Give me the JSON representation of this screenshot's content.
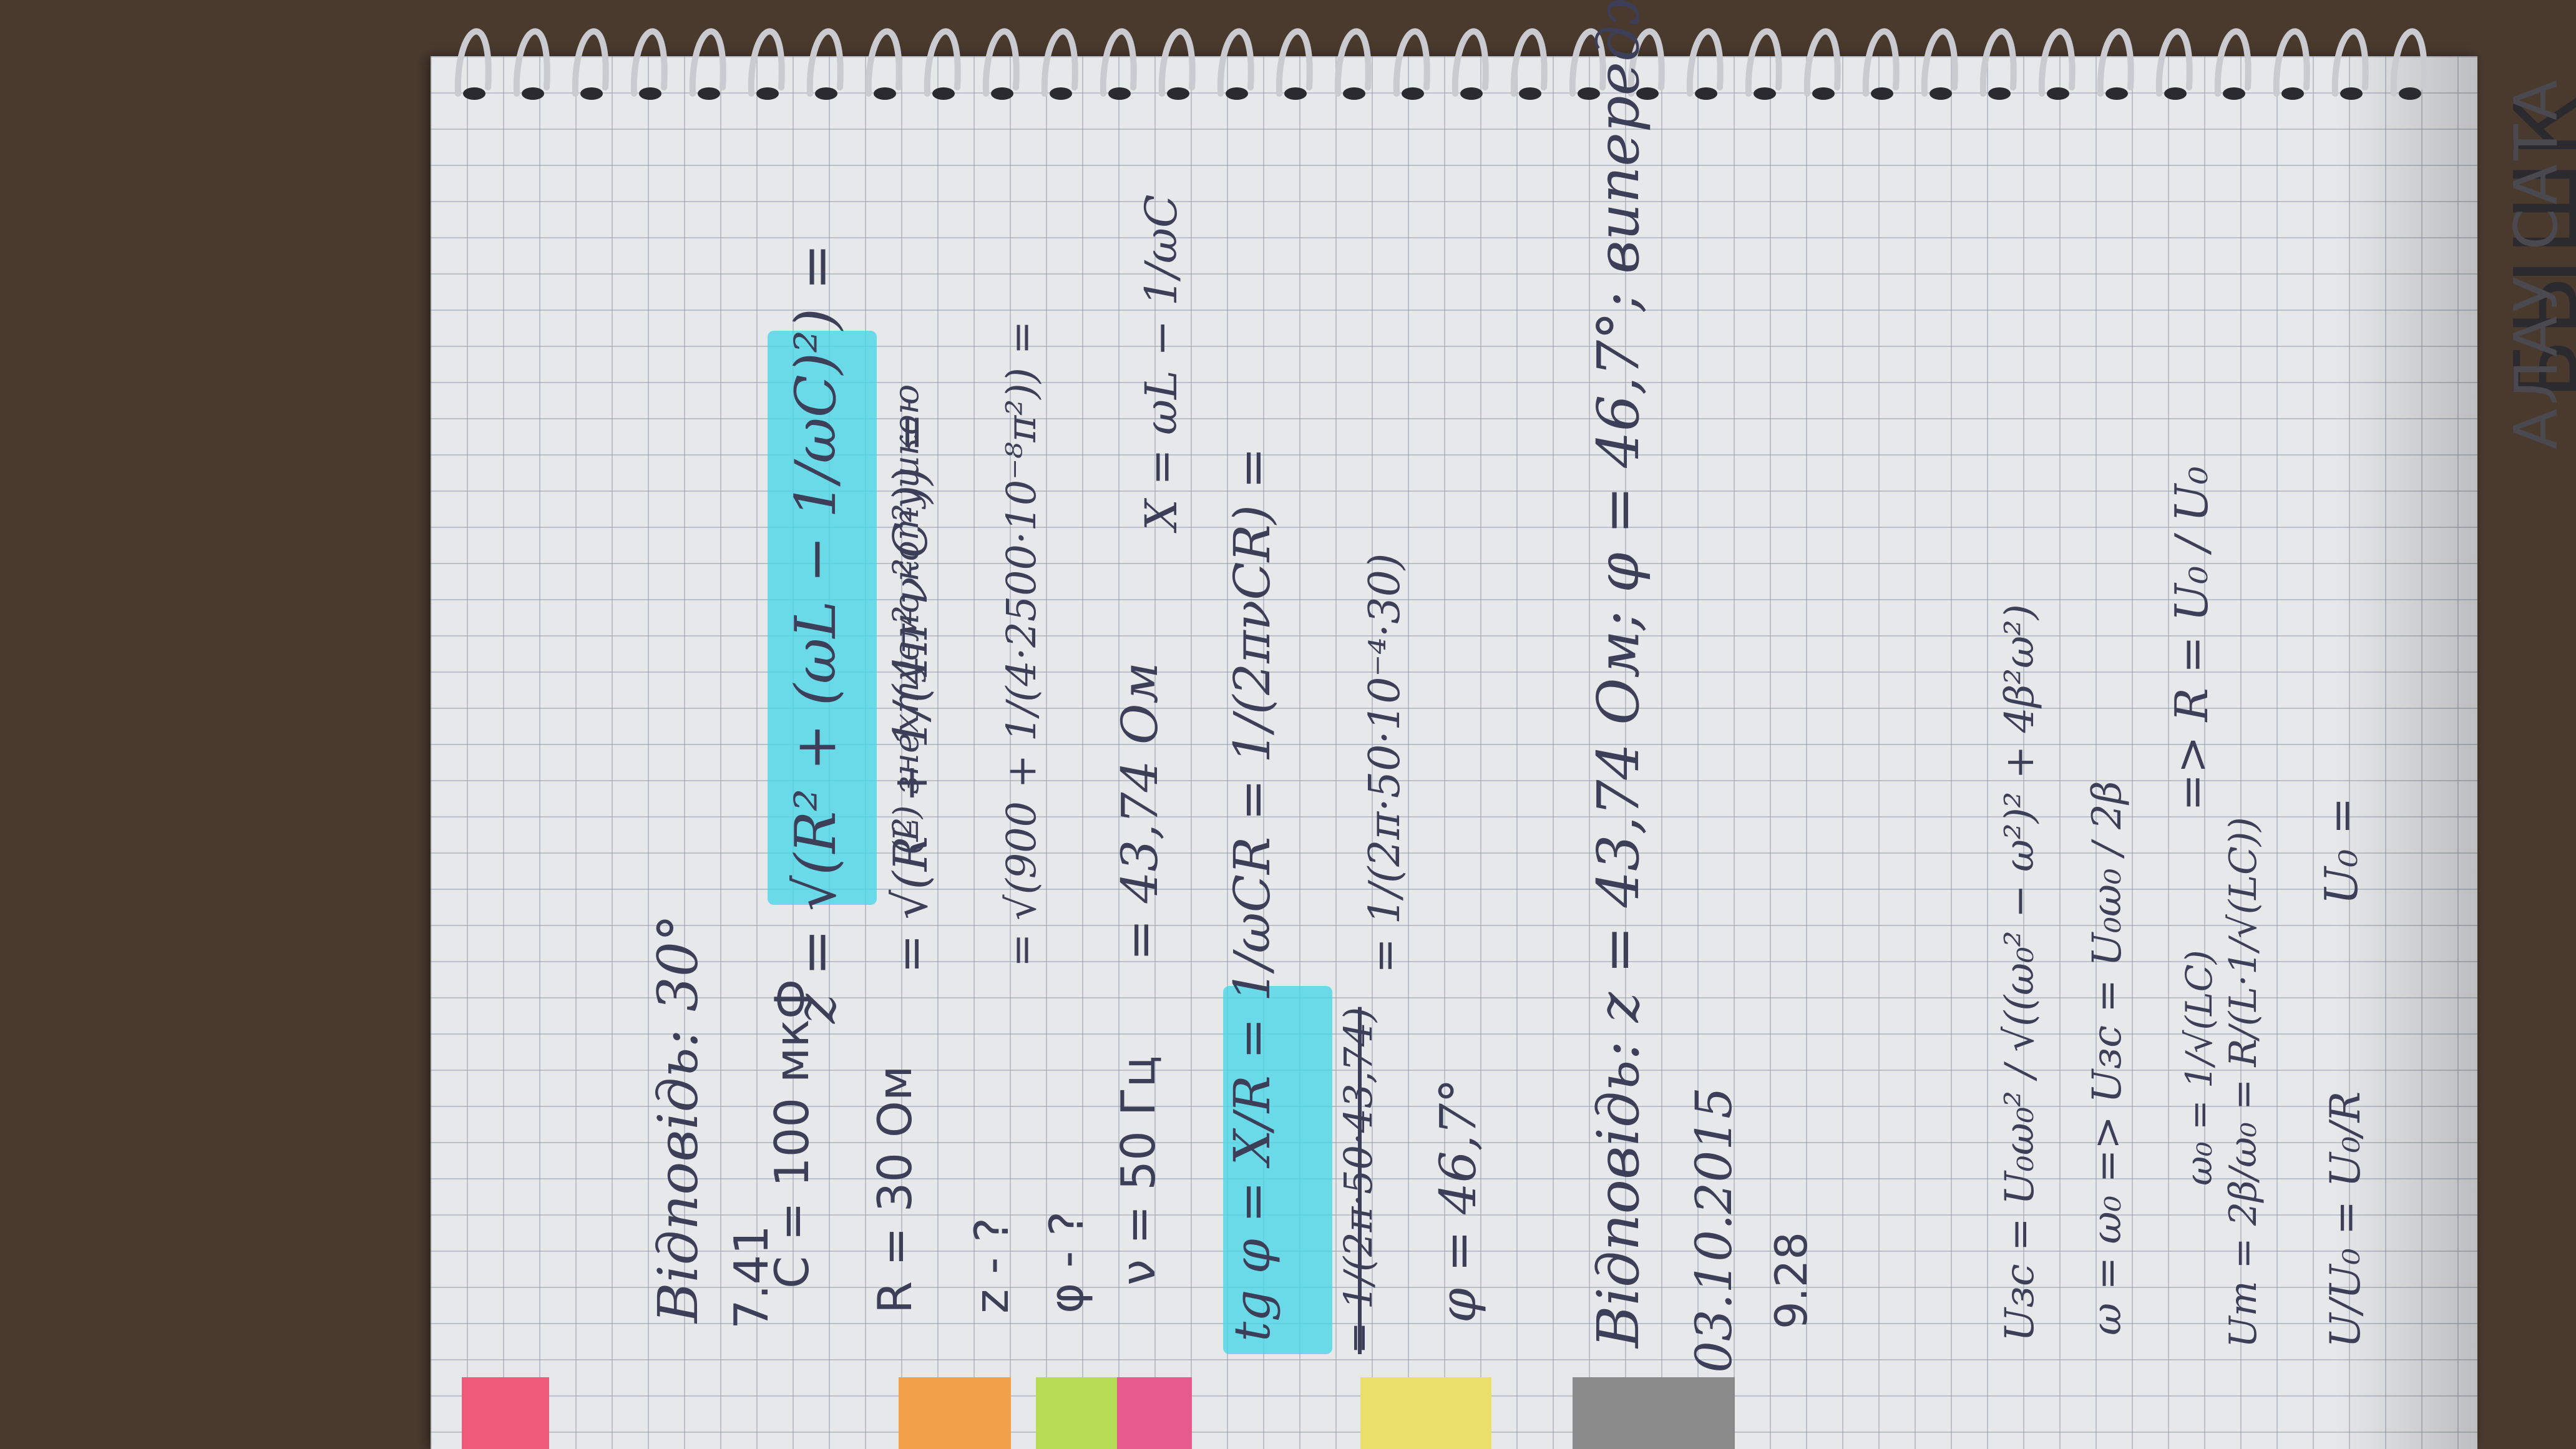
{
  "notebook": {
    "lines": [
      "Відповідь: 30°",
      "7.41",
      "C = 100 мкФ",
      "R = 30 Ом",
      "z - ?",
      "φ - ?",
      "ν = 50 Гц",
      "z = √(R² + (ωL − 1/ωC)²) =",
      "(L) знехтуємо котушкою",
      "= √(R² + 1/(4π²ν²C²)) =",
      "= √(900 + 1/(4·2500·10⁻⁸π²)) =",
      "= 43,74 Ом",
      "X = ωL − 1/ωC",
      "tg φ = X/R = 1/ωCR = 1/(2πνCR) =",
      "= 1/(2π·50·10⁻⁴·30)",
      "= 1/(2π·50·43,74)",
      "φ = 46,7°",
      "Відповідь: z = 43,74 Ом; φ = 46,7°; випередження",
      "03.10.2015",
      "9.28",
      "Uзс = U₀ω₀² / √((ω₀² − ω²)² + 4β²ω²)",
      "ω = ω₀ => Uзс = U₀ω₀ / 2β",
      "ω₀ = 1/√(LC)",
      "Uт = 2β/ω₀ = R/(L·1/√(LC))",
      "=> R = U₀ / U₀",
      "U₀ =",
      "U/U₀ = U₀/R"
    ]
  },
  "wall": {
    "lines": [
      "БЫШК",
      "АЛАУ САТА"
    ]
  },
  "colors": {
    "ink": "#3d3f58",
    "highlighter": "#40d6e8",
    "paper": "#e6e8ea"
  }
}
